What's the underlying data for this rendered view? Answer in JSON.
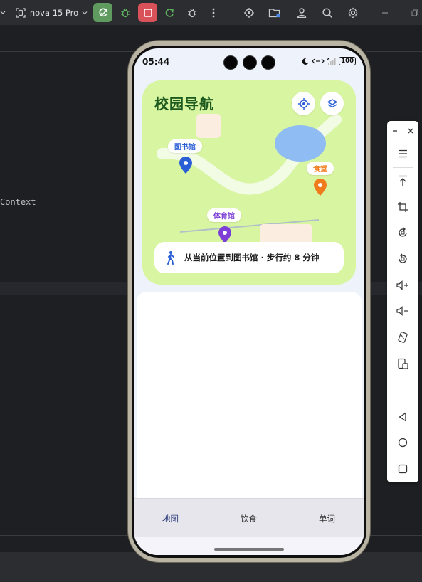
{
  "toolbar": {
    "device": "nova 15 Pro",
    "icons": [
      "device-frame-icon",
      "chevron-down-icon",
      "apply-changes-icon",
      "debug-icon",
      "stop-icon",
      "rerun-icon",
      "attach-debugger-icon",
      "more-icon",
      "record-icon",
      "project-icon",
      "profile-icon",
      "search-icon",
      "settings-icon",
      "minimize-icon",
      "restore-icon"
    ],
    "colors": {
      "bg": "#2b2d30",
      "run_green": "#5f9a5f",
      "stop_red": "#d9525a"
    }
  },
  "editor": {
    "code_fragment": "Context"
  },
  "phone": {
    "status_bar": {
      "time": "05:44",
      "battery": "100",
      "icons": [
        "moon-icon",
        "data-arrows-icon",
        "signal-icon",
        "battery-icon"
      ]
    },
    "map": {
      "title": "校园导航",
      "locate_icon": "crosshair-icon",
      "layers_icon": "layers-icon",
      "places": [
        {
          "name": "图书馆",
          "color": "#2a5fd6"
        },
        {
          "name": "食堂",
          "color": "#f07b1a"
        },
        {
          "name": "体育馆",
          "color": "#7d3fd6"
        }
      ],
      "route_icon": "walking-person-icon",
      "route_text": "从当前位置到图书馆 · 步行约 8 分钟",
      "colors": {
        "card_bg": "#d8f5a2",
        "lake": "#8fbcf2",
        "title": "#1d5a1d"
      }
    },
    "tabs": [
      {
        "label": "地图",
        "active": true
      },
      {
        "label": "饮食",
        "active": false
      },
      {
        "label": "单词",
        "active": false
      }
    ]
  },
  "side_panel": {
    "icons": [
      "minimize-icon",
      "close-icon",
      "menu-icon",
      "pin-to-top-icon",
      "crop-screenshot-icon",
      "rotate-icon",
      "rotate-alt-icon",
      "volume-up-icon",
      "volume-down-icon",
      "fold-icon",
      "screen-record-icon",
      "back-icon",
      "home-icon",
      "overview-icon"
    ]
  }
}
